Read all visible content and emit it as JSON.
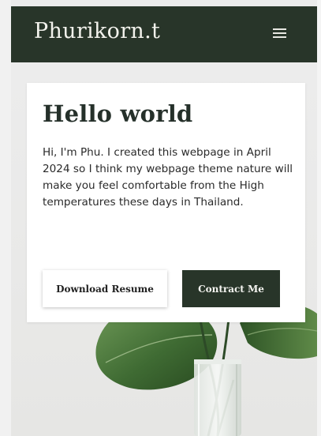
{
  "header": {
    "brand": "Phurikorn.t",
    "menu_icon": "hamburger-menu-icon"
  },
  "hero": {
    "title": "Hello world",
    "description": "Hi, I'm Phu. I created this webpage in April 2024 so I think my webpage theme nature will make you feel comfortable from the High temperatures these days in Thailand.",
    "primary_button": "Download Resume",
    "secondary_button": "Contract Me",
    "background_image": "monstera-leaf-in-glass-vase"
  },
  "colors": {
    "accent": "#283529",
    "card": "#ffffff",
    "background": "#ebebeb"
  }
}
